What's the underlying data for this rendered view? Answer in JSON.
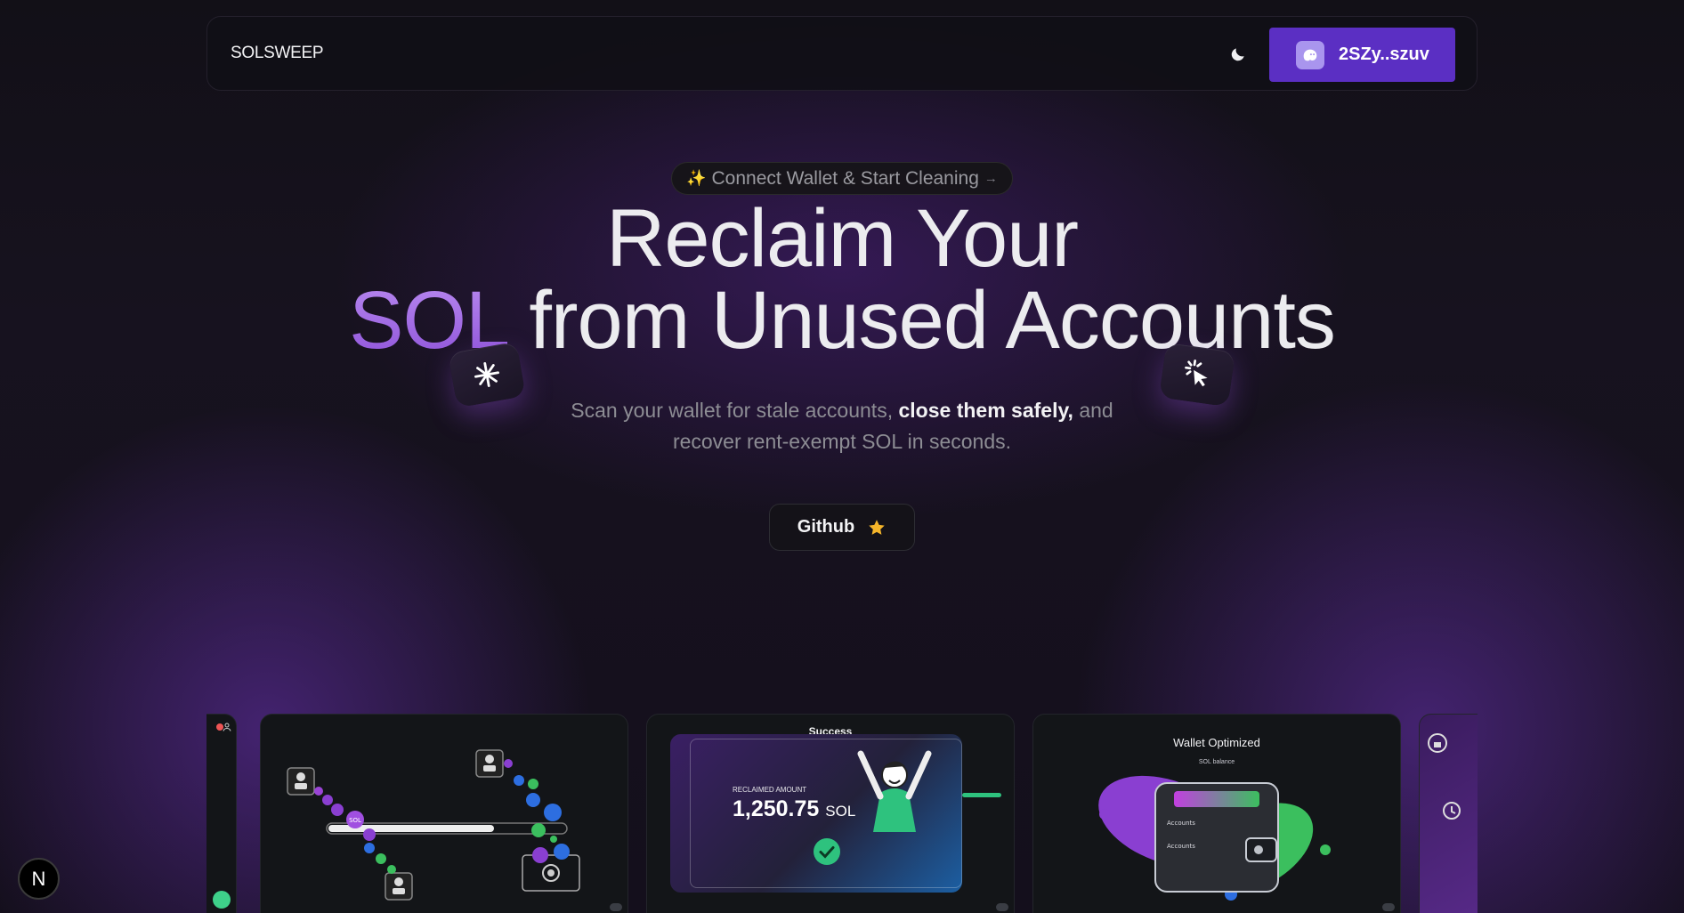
{
  "nav": {
    "brand": "SOLSWEEP",
    "wallet_label": "2SZy..szuv",
    "theme_icon": "moon-icon",
    "wallet_icon": "ghost-icon"
  },
  "hero": {
    "pill_text": "Connect Wallet & Start Cleaning",
    "pill_icon": "sparkles-icon",
    "headline_line1": "Reclaim Your",
    "headline_sol": "SOL",
    "headline_line2_rest": "from Unused Accounts",
    "subtitle_part1": "Scan your wallet for stale accounts, ",
    "subtitle_bold": "close them safely,",
    "subtitle_part2": " and",
    "subtitle_line2": "recover rent-exempt SOL in seconds.",
    "github_label": "Github",
    "github_icon": "star-icon"
  },
  "cards": {
    "success_title": "Success",
    "reclaimed_label": "RECLAIMED AMOUNT",
    "reclaimed_amount": "1,250.75",
    "reclaimed_unit": "SOL",
    "wallet_title": "Wallet Optimized",
    "wallet_subtitle": "SOL balance",
    "wallet_row1": "Accounts",
    "wallet_row2": "Accounts",
    "coin_label": "SOL"
  },
  "colors": {
    "accent_purple": "#5b2fc3",
    "sol_gradient_start": "#b98bf0",
    "sol_gradient_end": "#8e52d9",
    "success_green": "#2ec27e",
    "star_yellow": "#f5b52a"
  },
  "next_badge": "N"
}
